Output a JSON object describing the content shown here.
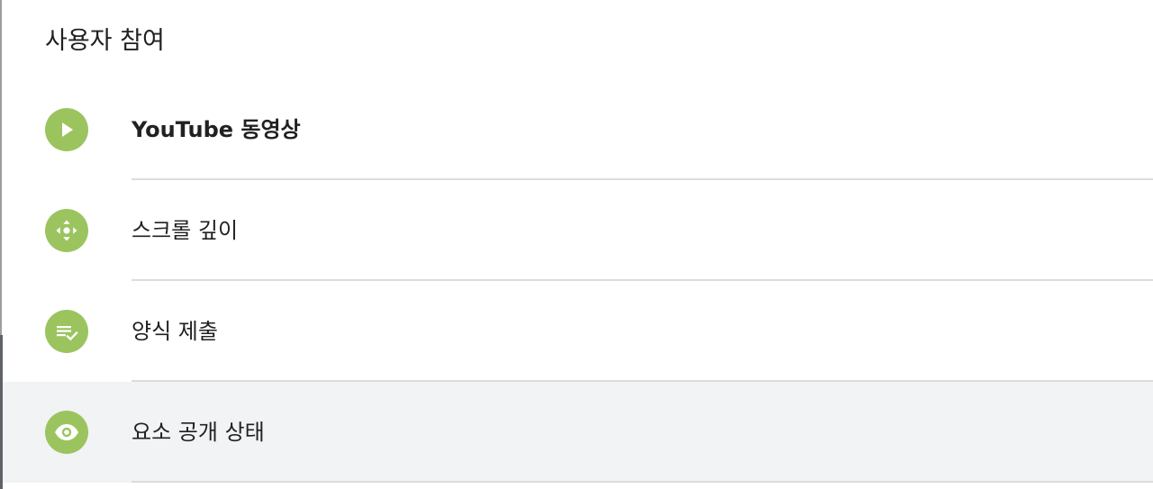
{
  "section": {
    "title": "사용자 참여"
  },
  "items": [
    {
      "label": "YouTube 동영상",
      "icon": "play-icon"
    },
    {
      "label": "스크롤 깊이",
      "icon": "scroll-arrows-icon"
    },
    {
      "label": "양식 제출",
      "icon": "form-check-icon"
    },
    {
      "label": "요소 공개 상태",
      "icon": "eye-icon",
      "selected": true
    }
  ],
  "colors": {
    "icon_bg": "#9bc45f",
    "selected_bg": "#f1f3f4",
    "divider": "#dadce0",
    "text": "#212121"
  }
}
